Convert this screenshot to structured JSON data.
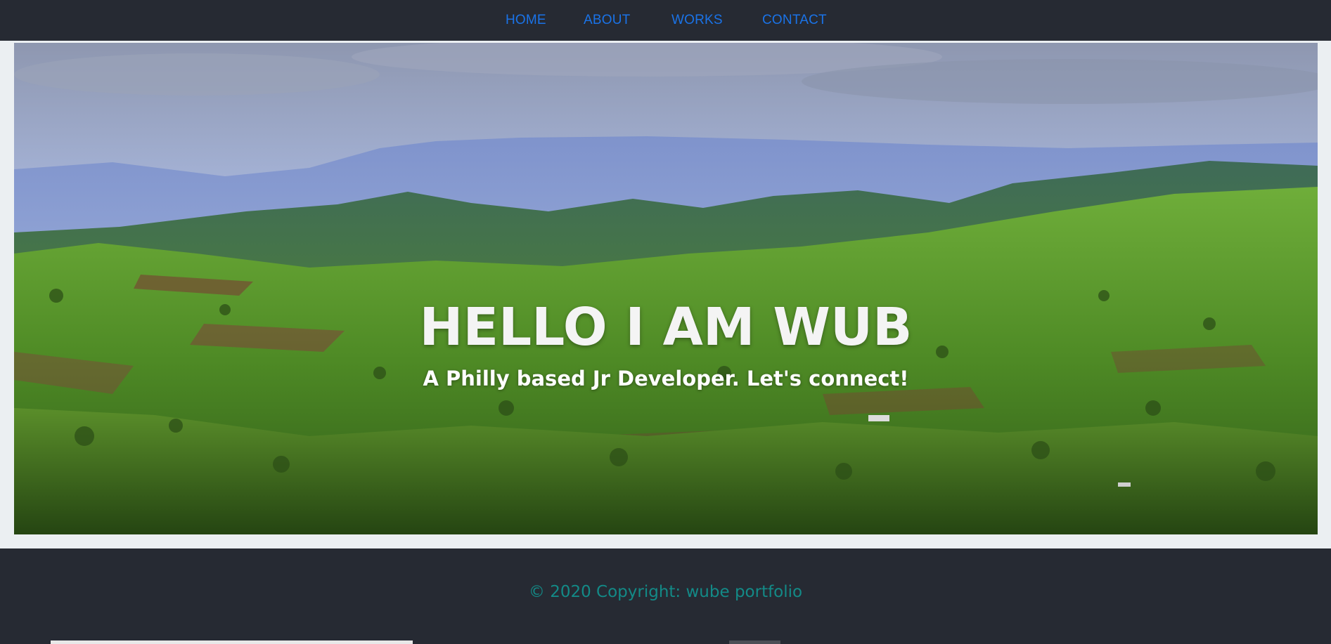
{
  "nav": {
    "items": [
      {
        "label": "HOME"
      },
      {
        "label": "ABOUT"
      },
      {
        "label": "WORKS"
      },
      {
        "label": "CONTACT"
      }
    ],
    "link_color": "#1a73e8"
  },
  "hero": {
    "title": "HELLO I AM WUB",
    "subtitle": "A Philly based Jr Developer. Let's connect!"
  },
  "footer": {
    "copyright": "© 2020 Copyright: wube portfolio",
    "text_color": "#138a87"
  },
  "colors": {
    "dark_bg": "#262a33",
    "light_bg": "#ebeff2"
  }
}
